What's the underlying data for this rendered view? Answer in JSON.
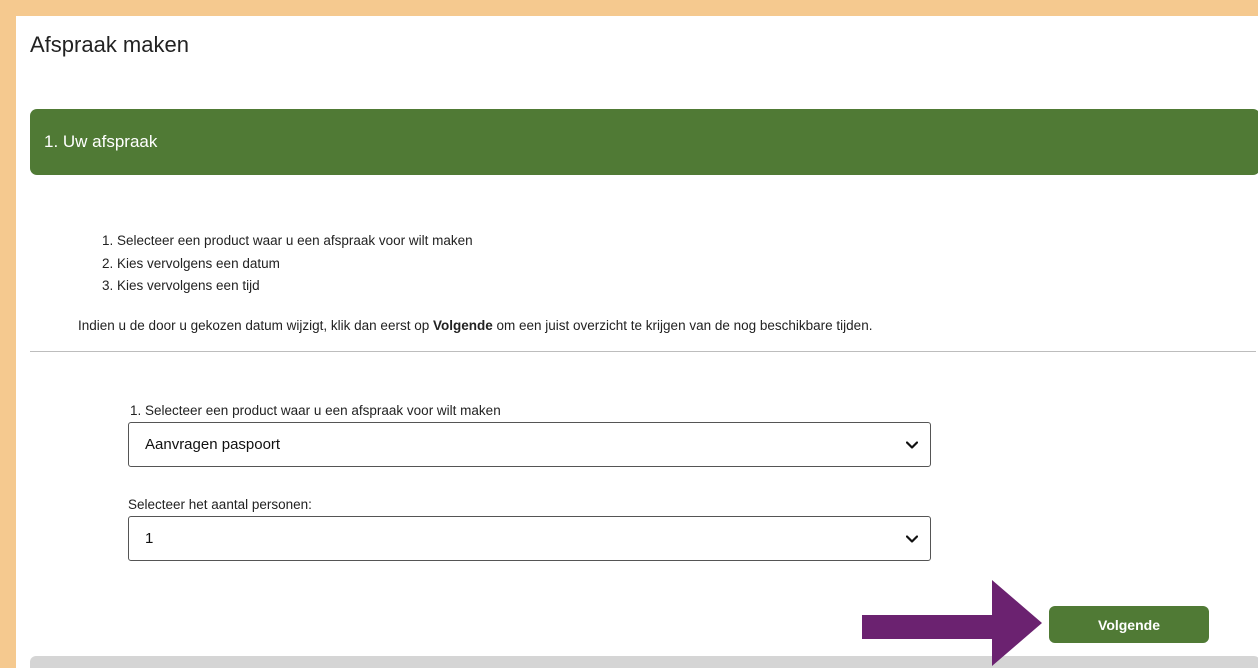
{
  "page": {
    "title": "Afspraak maken"
  },
  "step": {
    "header": "1. Uw afspraak"
  },
  "instructions": {
    "items": [
      "Selecteer een product waar u een afspraak voor wilt maken",
      "Kies vervolgens een datum",
      "Kies vervolgens een tijd"
    ],
    "note_before": "Indien u de door u gekozen datum wijzigt, klik dan eerst op ",
    "note_bold": "Volgende",
    "note_after": " om een juist overzicht te krijgen van de nog beschikbare tijden."
  },
  "form": {
    "product_label": "1. Selecteer een product waar u een afspraak voor wilt maken",
    "product_value": "Aanvragen paspoort",
    "persons_label": "Selecteer het aantal personen:",
    "persons_value": "1"
  },
  "actions": {
    "next_label": "Volgende"
  },
  "colors": {
    "background": "#f5c98f",
    "accent_green": "#507a35",
    "annotation_arrow": "#6b2270"
  },
  "icons": {
    "select_chevron": "chevron-down-icon",
    "annotation": "arrow-right-icon"
  }
}
